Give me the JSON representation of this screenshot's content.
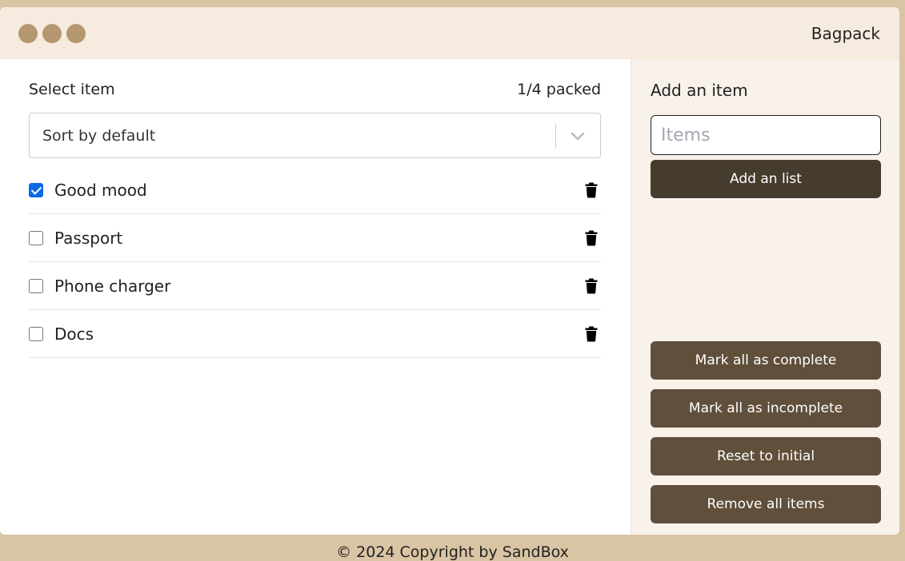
{
  "window": {
    "title": "Bagpack"
  },
  "list": {
    "header_label": "Select item",
    "packed_count": "1/4 packed",
    "sort_value": "Sort by default",
    "items": [
      {
        "label": "Good mood",
        "checked": true
      },
      {
        "label": "Passport",
        "checked": false
      },
      {
        "label": "Phone charger",
        "checked": false
      },
      {
        "label": "Docs",
        "checked": false
      }
    ]
  },
  "sidebar": {
    "add_label": "Add an item",
    "input_placeholder": "Items",
    "add_button": "Add an list",
    "actions": [
      "Mark all as complete",
      "Mark all as incomplete",
      "Reset to initial",
      "Remove all items"
    ]
  },
  "footer": {
    "text": "© 2024 Copyright by SandBox"
  },
  "colors": {
    "page_bg": "#d9c4a3",
    "titlebar_bg": "#f5ecdf",
    "dot": "#b59770",
    "sidebar_bg": "#f8f2eb",
    "add_button_bg": "#463c2e",
    "action_button_bg": "#5f4f3b",
    "checkbox_checked": "#0b69e6"
  }
}
